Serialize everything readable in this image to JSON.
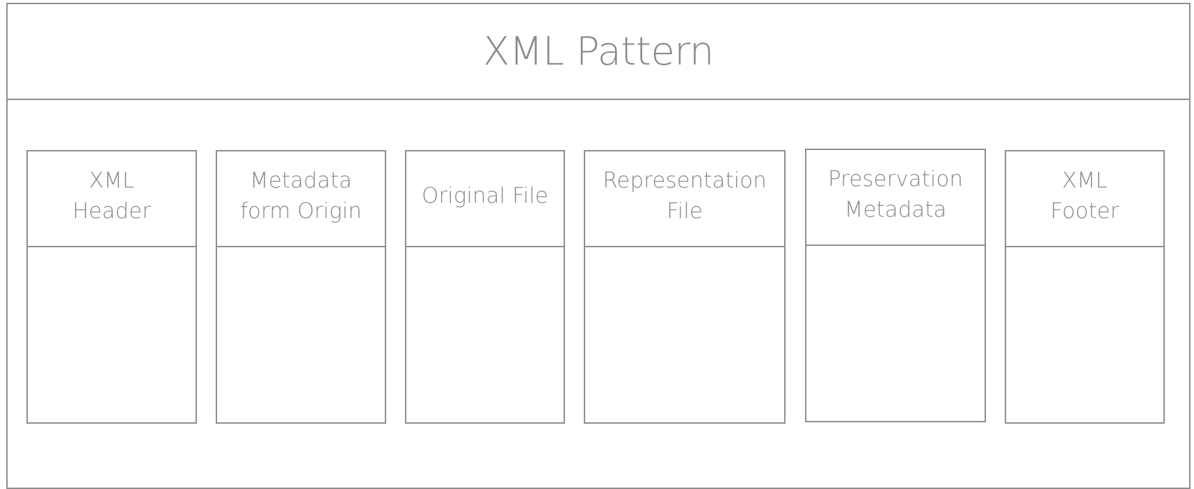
{
  "diagram": {
    "title": "XML Pattern",
    "columns": [
      {
        "id": "xml-header",
        "label_lines": [
          "XML",
          "Header"
        ]
      },
      {
        "id": "metadata-form-origin",
        "label_lines": [
          "Metadata",
          "form Origin"
        ]
      },
      {
        "id": "original-file",
        "label_lines": [
          "Original File"
        ]
      },
      {
        "id": "representation-file",
        "label_lines": [
          "Representation",
          "File"
        ]
      },
      {
        "id": "preservation-metadata",
        "label_lines": [
          "Preservation",
          "Metadata"
        ]
      },
      {
        "id": "xml-footer",
        "label_lines": [
          "XML",
          "Footer"
        ]
      }
    ]
  }
}
